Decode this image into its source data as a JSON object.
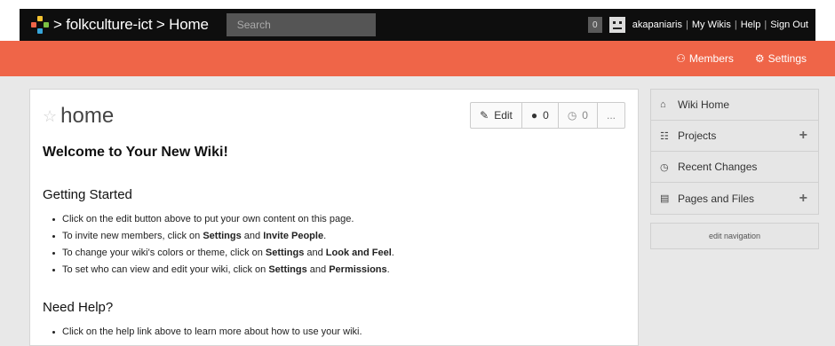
{
  "topbar": {
    "breadcrumb": "> folkculture-ict > Home",
    "search_placeholder": "Search",
    "notification_count": "0",
    "user": "akapaniaris",
    "links": [
      "My Wikis",
      "Help",
      "Sign Out"
    ]
  },
  "subnav": {
    "members_label": "Members",
    "settings_label": "Settings"
  },
  "page": {
    "title": "home",
    "toolbar": {
      "edit_label": "Edit",
      "comments_count": "0",
      "history_count": "0",
      "more_label": "..."
    },
    "welcome_heading": "Welcome to Your New Wiki!",
    "getting_started_heading": "Getting Started",
    "getting_started_items": [
      {
        "pre": "Click on the edit button above to put your own content on this page.",
        "b1": "",
        "mid": "",
        "b2": "",
        "post": ""
      },
      {
        "pre": "To invite new members, click on ",
        "b1": "Settings",
        "mid": " and ",
        "b2": "Invite People",
        "post": "."
      },
      {
        "pre": "To change your wiki's colors or theme, click on ",
        "b1": "Settings",
        "mid": " and ",
        "b2": "Look and Feel",
        "post": "."
      },
      {
        "pre": "To set who can view and edit your wiki, click on ",
        "b1": "Settings",
        "mid": " and ",
        "b2": "Permissions",
        "post": "."
      }
    ],
    "need_help_heading": "Need Help?",
    "need_help_items": [
      "Click on the help link above to learn more about how to use your wiki."
    ]
  },
  "sidebar": {
    "items": [
      {
        "label": "Wiki Home",
        "icon": "home-icon",
        "has_add": false
      },
      {
        "label": "Projects",
        "icon": "sitemap-icon",
        "has_add": true
      },
      {
        "label": "Recent Changes",
        "icon": "clock-icon",
        "has_add": false
      },
      {
        "label": "Pages and Files",
        "icon": "file-icon",
        "has_add": true
      }
    ],
    "edit_navigation_label": "edit navigation"
  },
  "colors": {
    "topbar": "#0e0e0e",
    "accent": "#ef6548",
    "sidebar_bg": "#e6e6e6"
  }
}
